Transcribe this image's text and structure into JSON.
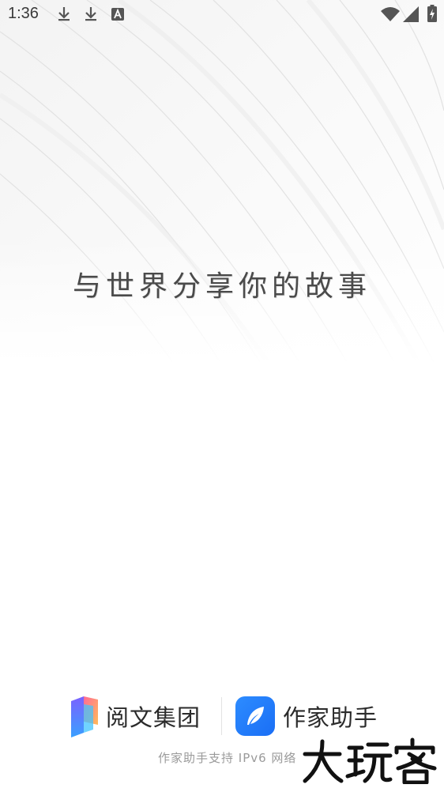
{
  "status_bar": {
    "time": "1:36",
    "icons": [
      "download-icon",
      "download-icon",
      "keyboard-a-icon",
      "wifi-icon",
      "signal-icon",
      "battery-charging-icon"
    ]
  },
  "splash": {
    "slogan": "与世界分享你的故事"
  },
  "footer": {
    "brand_primary": "阅文集团",
    "brand_secondary": "作家助手",
    "ipv6_note": "作家助手支持 IPv6 网络",
    "watermark": "大玩客"
  },
  "colors": {
    "assistant_blue": "#1a6ef5",
    "text_dark": "#2b2b2b",
    "note_gray": "#9a9a9a"
  }
}
